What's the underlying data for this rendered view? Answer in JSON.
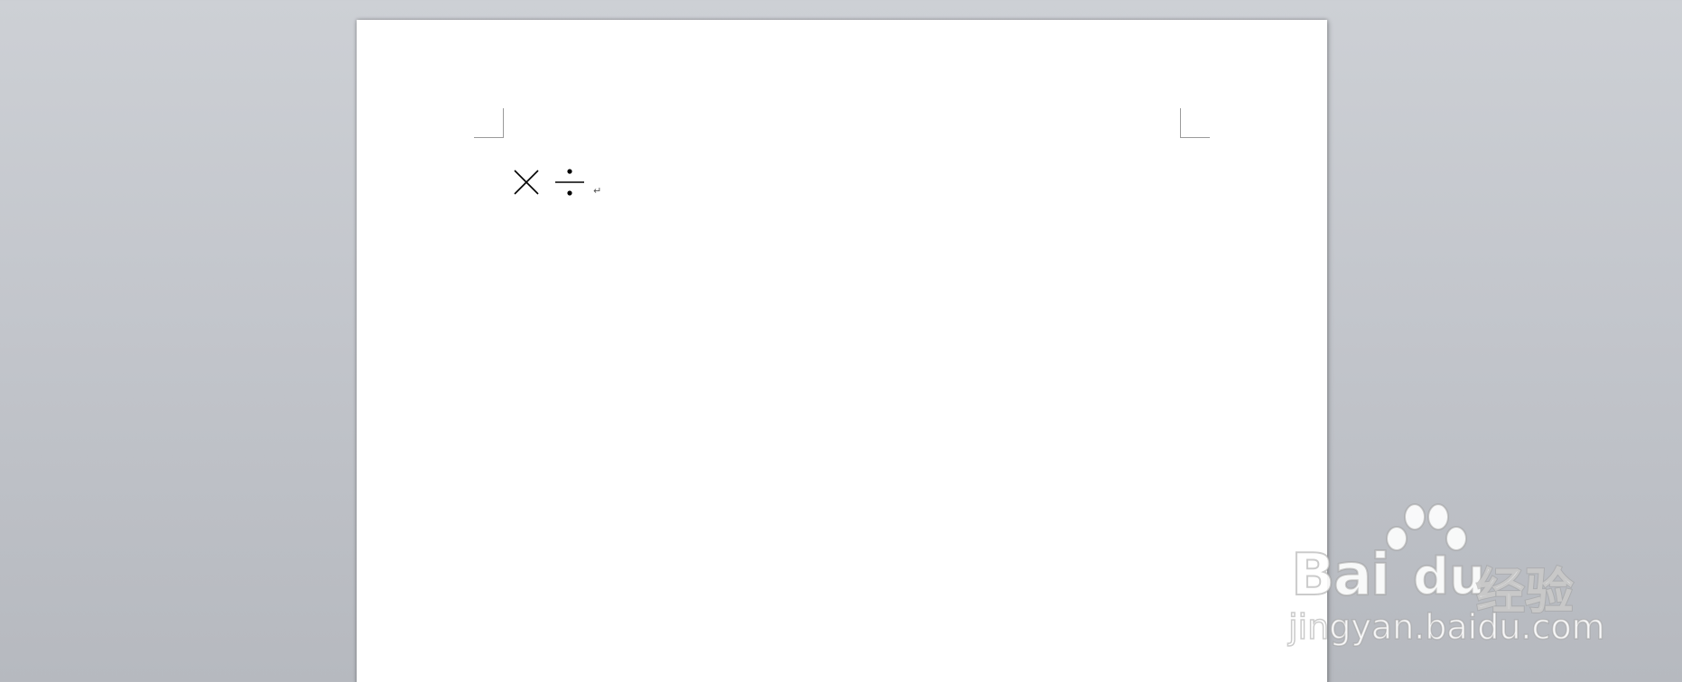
{
  "document": {
    "symbols": [
      "×",
      "÷"
    ],
    "paragraph_mark": "↵"
  },
  "watermark": {
    "brand_latin": "Bai",
    "brand_latin_tail": "du",
    "brand_cn": "经验",
    "url": "jingyan.baidu.com"
  },
  "colors": {
    "background_top": "#cdd0d5",
    "background_bottom": "#b6b9bf",
    "page": "#ffffff",
    "text": "#000000"
  }
}
